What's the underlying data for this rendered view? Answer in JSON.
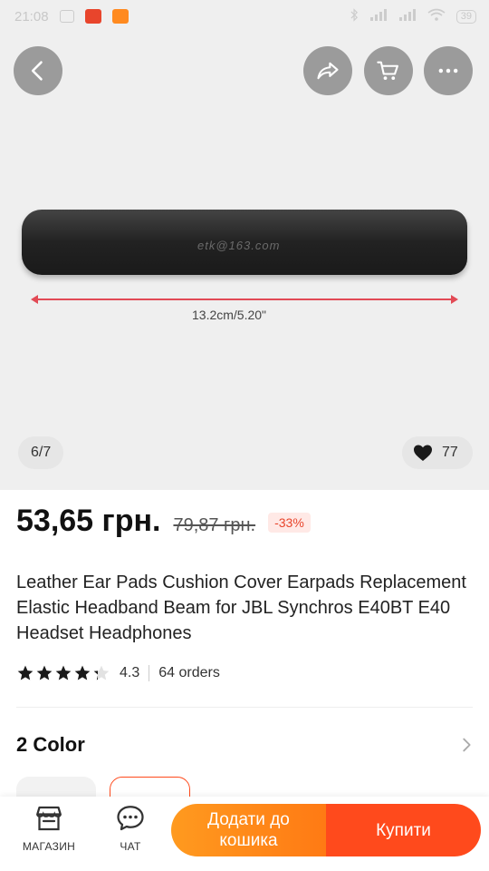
{
  "status_bar": {
    "time": "21:08",
    "battery": "39"
  },
  "gallery": {
    "watermark": "etk@163.com",
    "measure_label": "13.2cm/5.20\"",
    "counter": "6/7",
    "likes": "77"
  },
  "product": {
    "price": "53,65 грн.",
    "old_price": "79,87 грн.",
    "discount": "-33%",
    "title": "Leather Ear Pads Cushion Cover Earpads Replacement Elastic Headband Beam for JBL Synchros E40BT E40 Headset Headphones",
    "rating": "4.3",
    "rating_value": 4.3,
    "orders": "64 orders"
  },
  "variants": {
    "title": "2 Color"
  },
  "bottom_bar": {
    "store_label": "МАГАЗИН",
    "chat_label": "ЧАТ",
    "add_to_cart_label": "Додати до кошика",
    "buy_label": "Купити"
  },
  "colors": {
    "accent_orange": "#ff7a14",
    "accent_red": "#ff4a1c",
    "discount_red": "#e8452c"
  }
}
